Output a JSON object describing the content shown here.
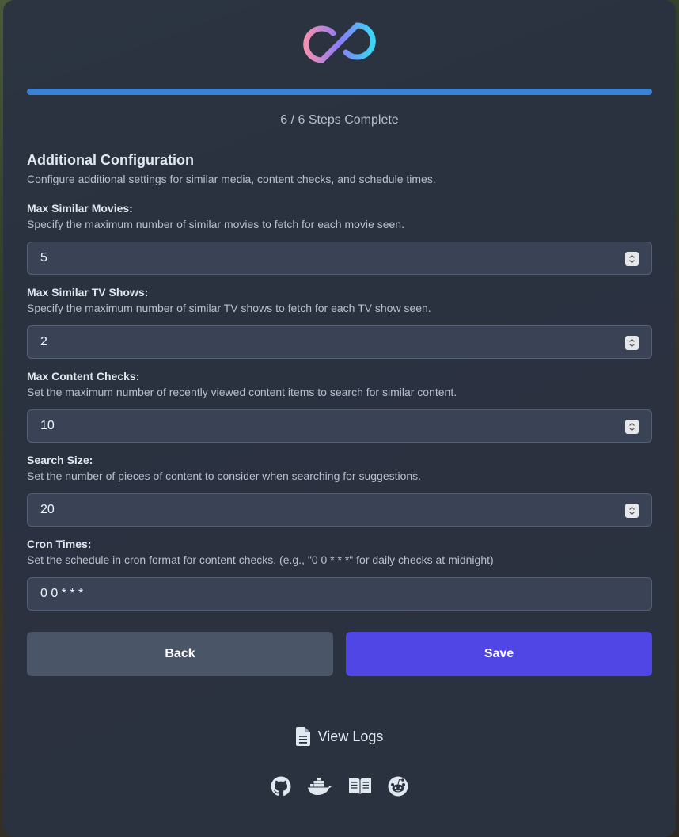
{
  "progress": {
    "fraction": 1.0,
    "steps_text": "6 / 6 Steps Complete"
  },
  "section": {
    "title": "Additional Configuration",
    "description": "Configure additional settings for similar media, content checks, and schedule times."
  },
  "fields": [
    {
      "label": "Max Similar Movies:",
      "help": "Specify the maximum number of similar movies to fetch for each movie seen.",
      "value": "5",
      "type": "number"
    },
    {
      "label": "Max Similar TV Shows:",
      "help": "Specify the maximum number of similar TV shows to fetch for each TV show seen.",
      "value": "2",
      "type": "number"
    },
    {
      "label": "Max Content Checks:",
      "help": "Set the maximum number of recently viewed content items to search for similar content.",
      "value": "10",
      "type": "number"
    },
    {
      "label": "Search Size:",
      "help": "Set the number of pieces of content to consider when searching for suggestions.",
      "value": "20",
      "type": "number"
    },
    {
      "label": "Cron Times:",
      "help": "Set the schedule in cron format for content checks. (e.g., \"0 0 * * *\" for daily checks at midnight)",
      "value": "0 0 * * *",
      "type": "text"
    }
  ],
  "buttons": {
    "back": "Back",
    "save": "Save"
  },
  "footer": {
    "view_logs": "View Logs",
    "icons": [
      "github-icon",
      "docker-icon",
      "book-icon",
      "reddit-icon"
    ]
  },
  "colors": {
    "accent": "#4f46e5",
    "progress": "#3b82d6",
    "back_button": "#4a5568"
  }
}
